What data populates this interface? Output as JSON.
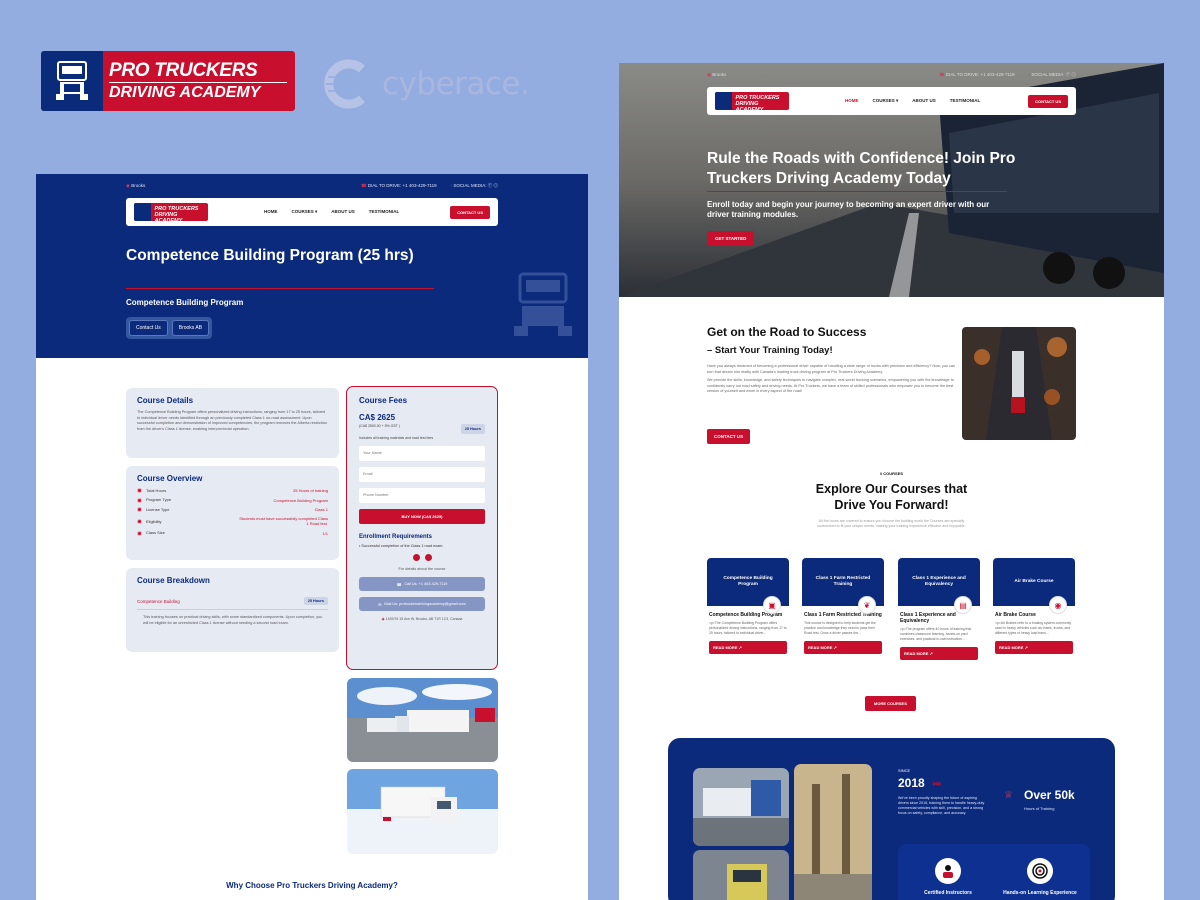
{
  "branding": {
    "logo_line1": "PRO TRUCKERS",
    "logo_line2": "DRIVING ACADEMY",
    "agency": "cyberace."
  },
  "left_page": {
    "topbar": {
      "location": "Brooks",
      "phone": "DIAL TO DRIVE: +1 403-429-7119",
      "social": "SOCIAL MEDIA:"
    },
    "nav": {
      "logo_line1": "PRO TRUCKERS",
      "logo_line2": "DRIVING ACADEMY",
      "items": [
        "HOME",
        "COURSES",
        "ABOUT US",
        "TESTIMONIAL"
      ],
      "cta": "CONTACT US"
    },
    "hero": {
      "title": "Competence Building Program (25 hrs)",
      "subtitle": "Competence Building Program",
      "buttons": [
        "Contact Us",
        "Brooks AB"
      ]
    },
    "course_details": {
      "title": "Course Details",
      "text": "The Competence Building Program offers personalized driving instructions, ranging from 17 to 25 hours, tailored to individual driver needs identified through an previously completed Class 1 on-road assessment. Upon successful completion and demonstration of improved competencies, the program removes the Alberta restriction from the driver's Class 1 license, enabling interprovincial operation."
    },
    "course_overview": {
      "title": "Course Overview",
      "rows": [
        {
          "label": "Total Hours",
          "value": "25 Hours of training"
        },
        {
          "label": "Program Type",
          "value": "Competence Building Program"
        },
        {
          "label": "License Type",
          "value": "Class 1"
        },
        {
          "label": "Eligibility",
          "value": "Students must have successfully completed Class 1 Road test."
        },
        {
          "label": "Class Size",
          "value": "1/1"
        }
      ]
    },
    "course_breakdown": {
      "title": "Course Breakdown",
      "item": "Competence Building",
      "hours": "25 Hours",
      "bullet": "This training focuses on practical driving skills, with some standardized components. Upon completion, you will be eligible for an unrestricted Class 1 license without needing a second road exam."
    },
    "course_fees": {
      "title": "Course Fees",
      "price": "CA$ 2625",
      "breakdown": "(CA$ 2500.00 + 5% GST )",
      "hours_badge": "25 Hours",
      "includes": "Includes all training materials and road test fees",
      "fields": [
        "Your Name",
        "Email",
        "Phone Number"
      ],
      "buy_label": "BUY NOW (CA$ 2625)",
      "requirements_title": "Enrollment Requirements",
      "requirement": "Successful completion of the Class 1 road exam.",
      "details_text": "For details about the course",
      "call": "Call Us: +1 403-429-7119",
      "mail": "Mail Us: protruckersdrivingacademy@gmail.com",
      "address": "1439/76 15 Ave W, Brooks, AB T1R 1C3, Canada"
    },
    "why_heading": "Why Choose Pro Truckers Driving Academy?"
  },
  "right_page": {
    "topbar": {
      "location": "Brooks",
      "phone": "DIAL TO DRIVE: +1 403-429-7119",
      "social": "SOCIAL MEDIA:"
    },
    "nav": {
      "items": [
        "HOME",
        "COURSES",
        "ABOUT US",
        "TESTIMONIAL"
      ],
      "cta": "CONTACT US"
    },
    "hero": {
      "title": "Rule the Roads with Confidence! Join Pro Truckers Driving Academy Today",
      "text": "Enroll today and begin your journey to becoming an expert driver with our driver training modules.",
      "cta": "GET STARTED"
    },
    "road_section": {
      "title": "Get on the Road to Success",
      "subtitle": "– Start Your Training Today!",
      "para1": "Have you always dreamed of becoming a professional driver capable of handling a wide range of trucks with precision and efficiency? Now, you can turn that dream into reality with Canada's leading truck driving program at Pro Truckers Driving Academy.",
      "para2": "We provide the skills, knowledge, and safety techniques to navigate complex, real-world trucking scenarios, empowering you with the knowledge to confidently carry out road safety and driving needs. At Pro Truckers, we have a team of skilled professionals who empower you to become the best version of yourself and excel in every aspect of the road!",
      "cta": "CONTACT US"
    },
    "courses": {
      "kicker": "// COURSES",
      "title": "Explore Our Courses that Drive You Forward!",
      "intro": "All the hours are covered to ensure you choose the building world the Courses are specially customized to fit your unique needs, making your training experience effective and enjoyable.",
      "cards": [
        {
          "banner": "Competence Building Program",
          "title": "Competence Building Program",
          "text": "<p>The Competence Building Program offers personalized driving instructions, ranging from 17 to 25 hours, tailored to individual driver...",
          "cta": "READ MORE ↗"
        },
        {
          "banner": "Class 1 Farm Restricted Training",
          "title": "Class 1 Farm Restricted Training",
          "text": "This course is designed to help students get the practice and knowledge they need to pass their Road test. Once a driver passes the...",
          "cta": "READ MORE ↗"
        },
        {
          "banner": "Class 1 Experience and Equivalency",
          "title": "Class 1 Experience and Equivalency",
          "text": "<p>The program offers 40 hours of training that combines classroom learning, hands-on yard exercises, and practical in-cab instruction...",
          "cta": "READ MORE ↗"
        },
        {
          "banner": "Air Brake Course",
          "title": "Air Brake Course",
          "text": "<p>Air Brakes refer to a braking system commonly used in heavy vehicles such as buses, trucks, and different types of heavy load trans...",
          "cta": "READ MORE ↗"
        }
      ],
      "more": "MORE COURSES"
    },
    "stats": {
      "since": "SINCE",
      "year": "2018",
      "arrows": "›››››",
      "desc": "We've been proudly shaping the future of aspiring drivers since 2018, training them to handle heavy-duty commercial vehicles with skill, precision, and a strong focus on safety, compliance, and accuracy.",
      "big": "Over 50k",
      "big_label": "Hours of Training",
      "features": [
        "Certified Instructors",
        "Hands-on Learning Experience"
      ]
    }
  },
  "colors": {
    "navy": "#0b2a7b",
    "red": "#c8102e",
    "background": "#94ade0"
  }
}
